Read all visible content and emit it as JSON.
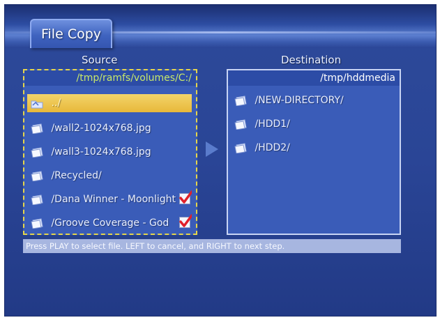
{
  "window": {
    "title": "File Copy"
  },
  "source": {
    "label": "Source",
    "path": "/tmp/ramfs/volumes/C:/",
    "items": [
      {
        "label": "../",
        "icon": "folder-up-icon",
        "selected": true,
        "checked": false
      },
      {
        "label": "/wall2-1024x768.jpg",
        "icon": "file-icon",
        "selected": false,
        "checked": false
      },
      {
        "label": "/wall3-1024x768.jpg",
        "icon": "file-icon",
        "selected": false,
        "checked": false
      },
      {
        "label": "/Recycled/",
        "icon": "folder-icon",
        "selected": false,
        "checked": false
      },
      {
        "label": "/Dana Winner - Moonlight",
        "icon": "file-icon",
        "selected": false,
        "checked": true
      },
      {
        "label": "/Groove Coverage - God",
        "icon": "file-icon",
        "selected": false,
        "checked": true
      }
    ]
  },
  "destination": {
    "label": "Destination",
    "path": "/tmp/hddmedia",
    "items": [
      {
        "label": "/NEW-DIRECTORY/",
        "icon": "folder-icon"
      },
      {
        "label": "/HDD1/",
        "icon": "drive-icon"
      },
      {
        "label": "/HDD2/",
        "icon": "drive-icon"
      }
    ]
  },
  "hint": {
    "text": "Press PLAY to select file. LEFT to cancel, and RIGHT to next step."
  },
  "colors": {
    "background": "#2a4596",
    "selection": "#e8b83a",
    "source_border": "#e6d64a",
    "source_path": "#c8e86a",
    "check": "#e0202a"
  }
}
